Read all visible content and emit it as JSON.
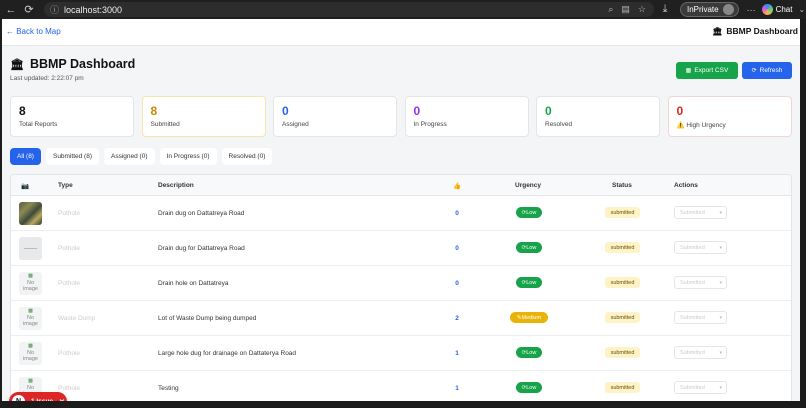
{
  "browser": {
    "url": "localhost:3000",
    "inprivate_label": "InPrivate",
    "chat_label": "Chat"
  },
  "topnav": {
    "back_label": "← Back to Map",
    "brand_label": "BBMP Dashboard"
  },
  "header": {
    "title": "BBMP Dashboard",
    "last_updated": "Last updated: 2:22:07 pm",
    "export_label": "Export CSV",
    "refresh_label": "Refresh"
  },
  "stats": [
    {
      "value": "8",
      "label": "Total Reports",
      "color": "#111111"
    },
    {
      "value": "8",
      "label": "Submitted",
      "color": "#ca8a04"
    },
    {
      "value": "0",
      "label": "Assigned",
      "color": "#2563eb"
    },
    {
      "value": "0",
      "label": "In Progress",
      "color": "#9333ea"
    },
    {
      "value": "0",
      "label": "Resolved",
      "color": "#16a34a"
    },
    {
      "value": "0",
      "label": "High Urgency",
      "color": "#dc2626"
    }
  ],
  "tabs": [
    "All (8)",
    "Submitted (8)",
    "Assigned (0)",
    "In Progress (0)",
    "Resolved (0)"
  ],
  "table": {
    "columns": [
      "📷",
      "Type",
      "Description",
      "👍",
      "Urgency",
      "Status",
      "Actions"
    ],
    "rows": [
      {
        "image": "photo",
        "type": "Pothole",
        "description": "Drain dug on Dattatreya Road",
        "votes": "0",
        "urgency": "Low",
        "urgency_level": "low",
        "status": "submitted",
        "action": "Submitted"
      },
      {
        "image": "blank",
        "type": "Pothole",
        "description": "Drain dug for Dattatreya Road",
        "votes": "0",
        "urgency": "Low",
        "urgency_level": "low",
        "status": "submitted",
        "action": "Submitted"
      },
      {
        "image": "none",
        "type": "Pothole",
        "description": "Drain hole on Dattatreya",
        "votes": "0",
        "urgency": "Low",
        "urgency_level": "low",
        "status": "submitted",
        "action": "Submitted"
      },
      {
        "image": "none",
        "type": "Waste Dump",
        "description": "Lot of Waste Dump being dumped",
        "votes": "2",
        "urgency": "Medium",
        "urgency_level": "medium",
        "status": "submitted",
        "action": "Submitted"
      },
      {
        "image": "none",
        "type": "Pothole",
        "description": "Large hole dug for drainage on Dattaterya Road",
        "votes": "1",
        "urgency": "Low",
        "urgency_level": "low",
        "status": "submitted",
        "action": "Submitted"
      },
      {
        "image": "none",
        "type": "Pothole",
        "description": "Testing",
        "votes": "1",
        "urgency": "Low",
        "urgency_level": "low",
        "status": "submitted",
        "action": "Submitted"
      }
    ],
    "no_image_label": "No image"
  },
  "issue_toast": {
    "initial": "N",
    "label": "1 Issue"
  }
}
